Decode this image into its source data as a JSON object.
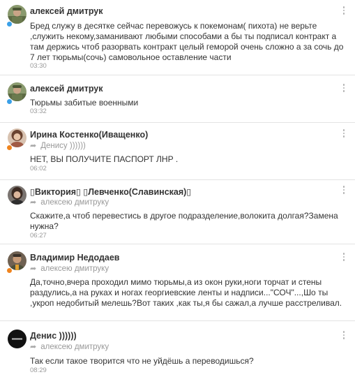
{
  "comments": [
    {
      "author": "алексей дмитрук",
      "reply_to": "",
      "text": "Бред служу в десятке сейчас перевожусь к покемонам( пихота) не верьте ,служить некому,заманивают любыми способами а бы ты подписал контракт а там держись чтоб разорвать контракт целый геморой очень сложно а за сочь до 7 лет тюрьмы(сочь) самовольное оставление части",
      "time": "03:30",
      "status_color": "#3aa0e8",
      "avatar_icon": "soldier-avatar-icon"
    },
    {
      "author": "алексей дмитрук",
      "reply_to": "",
      "text": "Тюрьмы забитые военными",
      "time": "03:32",
      "status_color": "#3aa0e8",
      "avatar_icon": "soldier-avatar-icon"
    },
    {
      "author": "Ирина Костенко(Иващенко)",
      "reply_to": "Денису ))))))",
      "text": "НЕТ, ВЫ ПОЛУЧИТЕ ПАСПОРТ ЛНР .",
      "time": "06:02",
      "status_color": "#f0841e",
      "avatar_icon": "woman-avatar-icon"
    },
    {
      "author": "▯Виктория▯ ▯Левченко(Славинская)▯",
      "reply_to": "алексею дмитруку",
      "text": "Скажите,а чтоб перевестись в другое подразделение,волокита долгая?Замена нужна?",
      "time": "06:27",
      "status_color": "",
      "avatar_icon": "woman-avatar-icon"
    },
    {
      "author": "Владимир Недодаев",
      "reply_to": "алексею дмитруку",
      "text": "Да,точно,вчера проходил мимо тюрьмы,а из окон руки,ноги торчат и стены раздулись,а на руках и ногах георгиевские ленты и надписи...\"СОЧ\"...,Шо ты ,укроп недобитый мелешь?Вот таких ,как ты,я бы сажал,а лучше расстреливал.",
      "time": "",
      "status_color": "#f0841e",
      "avatar_icon": "man-avatar-icon"
    },
    {
      "author": "Денис ))))))",
      "reply_to": "алексею дмитруку",
      "text": "Так если такое творится что не уйдёшь а переводишься?",
      "time": "08:29",
      "status_color": "",
      "avatar_icon": "dark-logo-avatar-icon"
    }
  ]
}
